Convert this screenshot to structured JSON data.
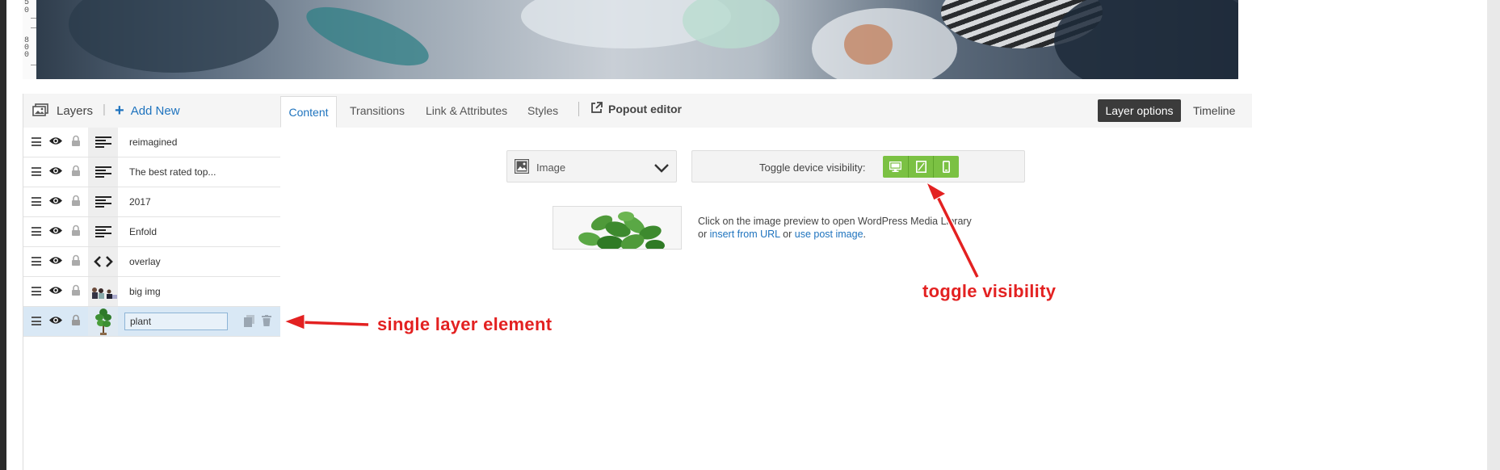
{
  "ruler": {
    "numbers": [
      "5",
      "0",
      "8",
      "0",
      "0"
    ]
  },
  "layers_panel": {
    "title": "Layers",
    "separator": "|",
    "add_new": "Add New",
    "layers": [
      {
        "name": "reimagined",
        "type_icon": "text-icon"
      },
      {
        "name": "The best rated top...",
        "type_icon": "text-icon"
      },
      {
        "name": "2017",
        "type_icon": "text-icon"
      },
      {
        "name": "Enfold",
        "type_icon": "text-icon"
      },
      {
        "name": "overlay",
        "type_icon": "code-icon"
      },
      {
        "name": "big img",
        "type_icon": "image-thumbnail"
      },
      {
        "name": "plant",
        "type_icon": "image-thumbnail",
        "active": true,
        "editing": true
      }
    ]
  },
  "tabs": {
    "content": "Content",
    "transitions": "Transitions",
    "link_attributes": "Link & Attributes",
    "styles": "Styles",
    "popout_editor": "Popout editor",
    "layer_options": "Layer options",
    "timeline": "Timeline"
  },
  "content": {
    "layer_type_select": "Image",
    "toggle_label": "Toggle device visibility:",
    "device_buttons": [
      "desktop-icon",
      "tablet-icon",
      "mobile-icon"
    ],
    "media_text_line1": "Click on the image preview to open WordPress Media Library",
    "media_text_or": "or",
    "insert_from_url": "insert from URL",
    "media_text_or2": "or",
    "use_post_image": "use post image",
    "period": "."
  },
  "annotations": {
    "toggle_visibility": "toggle visibility",
    "single_layer_element": "single layer element"
  },
  "colors": {
    "accent_blue": "#1e73be",
    "toggle_green": "#7bc143",
    "annotation_red": "#e32121",
    "dark_button": "#3b3b3b",
    "active_row": "#d9e8f5"
  }
}
